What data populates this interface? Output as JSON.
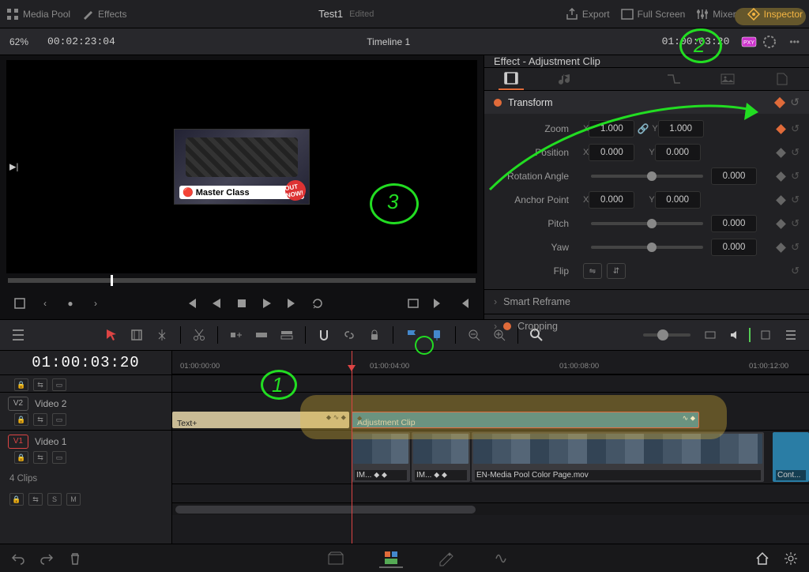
{
  "topbar": {
    "left": [
      {
        "icon": "grid",
        "label": "Media Pool"
      },
      {
        "icon": "wand",
        "label": "Effects"
      }
    ],
    "title": "Test1",
    "edited": "Edited",
    "right": [
      {
        "icon": "export",
        "label": "Export"
      },
      {
        "icon": "fullscreen",
        "label": "Full Screen"
      },
      {
        "icon": "mixer",
        "label": "Mixer"
      },
      {
        "icon": "inspector",
        "label": "Inspector",
        "active": true
      }
    ]
  },
  "subbar": {
    "zoom": "62%",
    "source_tc": "00:02:23:04",
    "timeline_name": "Timeline 1",
    "record_tc": "01:00:03:20"
  },
  "viewer": {
    "thumb_label": "Master Class",
    "thumb_badge": "OUT NOW!"
  },
  "inspector": {
    "header": "Effect - Adjustment Clip",
    "section": "Transform",
    "rows": {
      "zoom": {
        "label": "Zoom",
        "x": "1.000",
        "y": "1.000",
        "kf": "orange"
      },
      "position": {
        "label": "Position",
        "x": "0.000",
        "y": "0.000"
      },
      "rotation": {
        "label": "Rotation Angle",
        "val": "0.000"
      },
      "anchor": {
        "label": "Anchor Point",
        "x": "0.000",
        "y": "0.000"
      },
      "pitch": {
        "label": "Pitch",
        "val": "0.000"
      },
      "yaw": {
        "label": "Yaw",
        "val": "0.000"
      },
      "flip": {
        "label": "Flip"
      }
    },
    "collapsed": [
      "Smart Reframe",
      "Cropping"
    ]
  },
  "timeline": {
    "master_tc": "01:00:03:20",
    "ruler": [
      "01:00:00:00",
      "01:00:04:00",
      "01:00:08:00",
      "01:00:12:00"
    ],
    "tracks": [
      {
        "tag": "V2",
        "name": "Video 2"
      },
      {
        "tag": "V1",
        "name": "Video 1",
        "active": true
      }
    ],
    "clips_count": "4 Clips",
    "clip_labels": {
      "text": "Text+",
      "adj": "Adjustment Clip",
      "v1a": "IM...",
      "v1b": "IM...",
      "v1c": "EN-Media Pool Color Page.mov",
      "v1d": "Cont..."
    }
  },
  "annotations": {
    "1": "1",
    "2": "2",
    "3": "3"
  }
}
